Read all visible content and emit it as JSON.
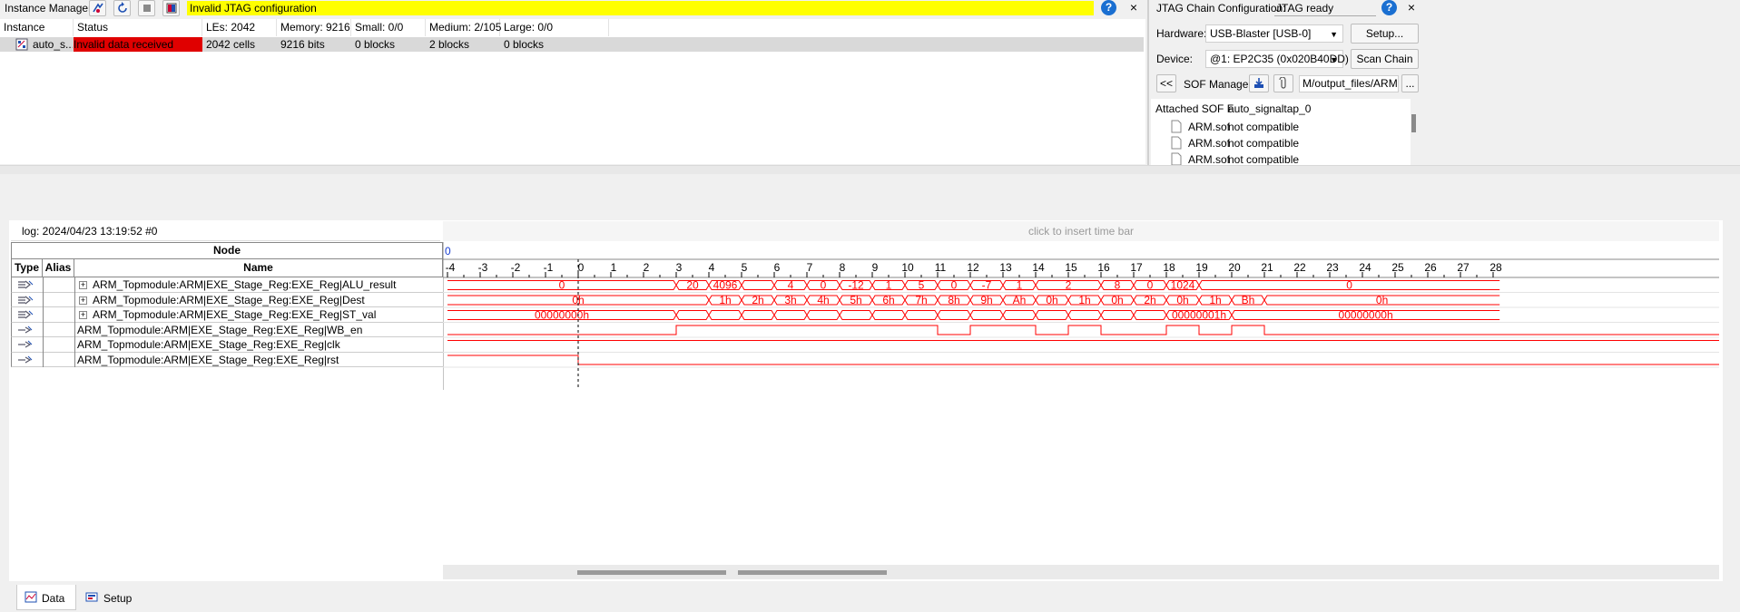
{
  "instance_manager": {
    "title": "Instance Manager:",
    "status_message": "Invalid JTAG configuration",
    "columns": [
      "Instance",
      "Status",
      "LEs: 2042",
      "Memory: 9216",
      "Small: 0/0",
      "Medium: 2/105",
      "Large: 0/0"
    ],
    "row": {
      "instance": "auto_s...",
      "status": "Invalid data received",
      "les": "2042 cells",
      "memory": "9216 bits",
      "small": "0 blocks",
      "medium": "2 blocks",
      "large": "0 blocks"
    }
  },
  "jtag": {
    "title": "JTAG Chain Configuration:",
    "status": "JTAG ready",
    "hardware_label": "Hardware:",
    "hardware_value": "USB-Blaster [USB-0]",
    "setup_label": "Setup...",
    "device_label": "Device:",
    "device_value": "@1: EP2C35 (0x020B40DD)",
    "scan_chain_label": "Scan Chain",
    "collapse_label": "<<",
    "sof_manager_label": "SOF Manager:",
    "sof_path": "M/output_files/ARM.sof",
    "browse_label": "...",
    "attached_label": "Attached SOF F",
    "attached_value": "auto_signaltap_0",
    "sof_list": [
      {
        "file": "ARM.sof",
        "status": "not compatible"
      },
      {
        "file": "ARM.sof",
        "status": "not compatible"
      },
      {
        "file": "ARM.sof",
        "status": "not compatible"
      }
    ]
  },
  "waveform": {
    "log_label": "log: 2024/04/23 13:19:52  #0",
    "time_bar_hint": "click to insert time bar",
    "node_header": "Node",
    "type_header": "Type",
    "alias_header": "Alias",
    "name_header": "Name",
    "cursor_label": "0",
    "ticks": [
      "-4",
      "-3",
      "-2",
      "-1",
      "0",
      "1",
      "2",
      "3",
      "4",
      "5",
      "6",
      "7",
      "8",
      "9",
      "10",
      "11",
      "12",
      "13",
      "14",
      "15",
      "16",
      "17",
      "18",
      "19",
      "20",
      "21",
      "22",
      "23",
      "24",
      "25",
      "26",
      "27",
      "28"
    ],
    "signals": [
      {
        "name": "ARM_Topmodule:ARM|EXE_Stage_Reg:EXE_Reg|ALU_result",
        "expandable": true,
        "kind": "bus",
        "segments": [
          {
            "from": -4,
            "to": 3,
            "label": "0"
          },
          {
            "from": 3,
            "to": 4,
            "label": "20"
          },
          {
            "from": 4,
            "to": 5,
            "label": "4096"
          },
          {
            "from": 5,
            "to": 6,
            "label": ""
          },
          {
            "from": 6,
            "to": 7,
            "label": "4"
          },
          {
            "from": 7,
            "to": 8,
            "label": "0"
          },
          {
            "from": 8,
            "to": 9,
            "label": "-12"
          },
          {
            "from": 9,
            "to": 10,
            "label": "1"
          },
          {
            "from": 10,
            "to": 11,
            "label": "5"
          },
          {
            "from": 11,
            "to": 12,
            "label": "0"
          },
          {
            "from": 12,
            "to": 13,
            "label": "-7"
          },
          {
            "from": 13,
            "to": 14,
            "label": "1"
          },
          {
            "from": 14,
            "to": 16,
            "label": "2"
          },
          {
            "from": 16,
            "to": 17,
            "label": "8"
          },
          {
            "from": 17,
            "to": 18,
            "label": "0"
          },
          {
            "from": 18,
            "to": 19,
            "label": "1024"
          },
          {
            "from": 19,
            "to": 28.2,
            "label": "0"
          }
        ]
      },
      {
        "name": "ARM_Topmodule:ARM|EXE_Stage_Reg:EXE_Reg|Dest",
        "expandable": true,
        "kind": "bus",
        "segments": [
          {
            "from": -4,
            "to": 4,
            "label": "0h"
          },
          {
            "from": 4,
            "to": 5,
            "label": "1h"
          },
          {
            "from": 5,
            "to": 6,
            "label": "2h"
          },
          {
            "from": 6,
            "to": 7,
            "label": "3h"
          },
          {
            "from": 7,
            "to": 8,
            "label": "4h"
          },
          {
            "from": 8,
            "to": 9,
            "label": "5h"
          },
          {
            "from": 9,
            "to": 10,
            "label": "6h"
          },
          {
            "from": 10,
            "to": 11,
            "label": "7h"
          },
          {
            "from": 11,
            "to": 12,
            "label": "8h"
          },
          {
            "from": 12,
            "to": 13,
            "label": "9h"
          },
          {
            "from": 13,
            "to": 14,
            "label": "Ah"
          },
          {
            "from": 14,
            "to": 15,
            "label": "0h"
          },
          {
            "from": 15,
            "to": 16,
            "label": "1h"
          },
          {
            "from": 16,
            "to": 17,
            "label": "0h"
          },
          {
            "from": 17,
            "to": 18,
            "label": "2h"
          },
          {
            "from": 18,
            "to": 19,
            "label": "0h"
          },
          {
            "from": 19,
            "to": 20,
            "label": "1h"
          },
          {
            "from": 20,
            "to": 21,
            "label": "Bh"
          },
          {
            "from": 21,
            "to": 28.2,
            "label": "0h"
          }
        ]
      },
      {
        "name": "ARM_Topmodule:ARM|EXE_Stage_Reg:EXE_Reg|ST_val",
        "expandable": true,
        "kind": "bus",
        "segments": [
          {
            "from": -4,
            "to": 3,
            "label": "00000000h"
          },
          {
            "from": 3,
            "to": 4,
            "label": ""
          },
          {
            "from": 4,
            "to": 5,
            "label": ""
          },
          {
            "from": 5,
            "to": 6,
            "label": ""
          },
          {
            "from": 6,
            "to": 7,
            "label": ""
          },
          {
            "from": 7,
            "to": 8,
            "label": ""
          },
          {
            "from": 8,
            "to": 9,
            "label": ""
          },
          {
            "from": 9,
            "to": 10,
            "label": ""
          },
          {
            "from": 10,
            "to": 11,
            "label": ""
          },
          {
            "from": 11,
            "to": 12,
            "label": ""
          },
          {
            "from": 12,
            "to": 13,
            "label": ""
          },
          {
            "from": 13,
            "to": 14,
            "label": ""
          },
          {
            "from": 14,
            "to": 15,
            "label": ""
          },
          {
            "from": 15,
            "to": 16,
            "label": ""
          },
          {
            "from": 16,
            "to": 17,
            "label": ""
          },
          {
            "from": 17,
            "to": 18,
            "label": ""
          },
          {
            "from": 18,
            "to": 20,
            "label": "00000001h"
          },
          {
            "from": 20,
            "to": 28.2,
            "label": "00000000h"
          }
        ]
      },
      {
        "name": "ARM_Topmodule:ARM|EXE_Stage_Reg:EXE_Reg|WB_en",
        "expandable": false,
        "kind": "bit",
        "transitions": [
          [
            -4,
            0
          ],
          [
            3,
            1
          ],
          [
            11,
            0
          ],
          [
            12,
            1
          ],
          [
            14,
            0
          ],
          [
            15,
            1
          ],
          [
            16,
            0
          ],
          [
            18,
            1
          ],
          [
            19,
            0
          ],
          [
            20,
            1
          ],
          [
            21,
            0
          ]
        ]
      },
      {
        "name": "ARM_Topmodule:ARM|EXE_Stage_Reg:EXE_Reg|clk",
        "expandable": false,
        "kind": "bit",
        "transitions": [
          [
            -4,
            1
          ]
        ]
      },
      {
        "name": "ARM_Topmodule:ARM|EXE_Stage_Reg:EXE_Reg|rst",
        "expandable": false,
        "kind": "bit",
        "transitions": [
          [
            -4,
            1
          ],
          [
            0,
            0
          ]
        ]
      }
    ]
  },
  "bottom_tabs": [
    {
      "label": "Data",
      "icon": "data-icon",
      "active": true
    },
    {
      "label": "Setup",
      "icon": "setup-icon",
      "active": false
    }
  ],
  "colors": {
    "accent_red": "#e00000",
    "status_yellow": "#ffff00",
    "status_red": "#e00000",
    "wave": "#ff0000"
  }
}
